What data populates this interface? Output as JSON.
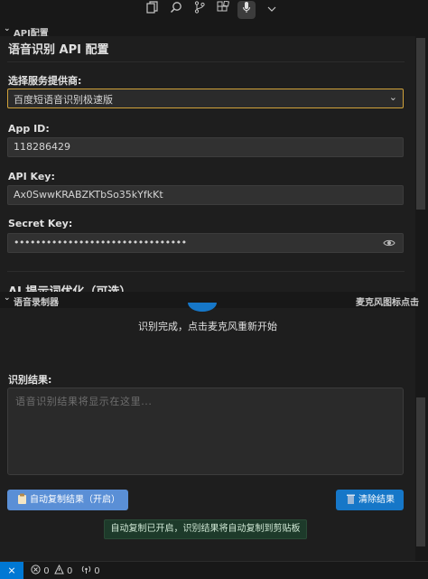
{
  "toolbar": {
    "icons": [
      "copy-icon",
      "search-icon",
      "source-control-icon",
      "extensions-icon",
      "microphone-icon",
      "chevron-down-icon"
    ]
  },
  "api_section": {
    "header": "API配置",
    "title": "语音识别 API 配置",
    "provider_label": "选择服务提供商:",
    "provider_value": "百度短语音识别极速版",
    "app_id_label": "App ID:",
    "app_id_value": "118286429",
    "api_key_label": "API Key:",
    "api_key_value": "Ax0SwwKRABZKTbSo35kYfkKt",
    "secret_key_label": "Secret Key:",
    "secret_key_value": "••••••••••••••••••••••••••••••••",
    "next_heading_partial": "AI 提示词优化（可选）"
  },
  "recorder_section": {
    "header": "语音录制器",
    "header_right": "麦克风图标点击",
    "status_text": "识别完成，点击麦克风重新开始",
    "result_label": "识别结果:",
    "result_placeholder": "语音识别结果将显示在这里...",
    "copy_button": "自动复制结果（开启）",
    "clear_button": "清除结果",
    "notice": "自动复制已开启，识别结果将自动复制到剪贴板"
  },
  "statusbar": {
    "errors": "0",
    "warnings": "0",
    "ports": "0"
  },
  "colors": {
    "accent_blue": "#0078d4",
    "select_border": "#d1a23a",
    "copy_button": "#5a8fd6",
    "clear_button": "#1677c8",
    "notice_bg": "#1d3a2a"
  }
}
